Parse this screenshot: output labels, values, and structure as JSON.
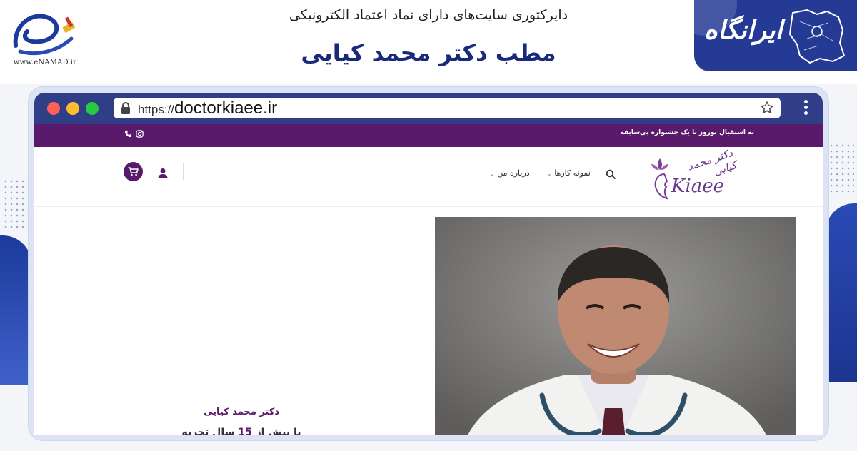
{
  "banner": {
    "enamad_url": "www.eNAMAD.ir",
    "subtitle": "دایرکتوری سایت‌های دارای نماد اعتماد الکترونیکی",
    "title": "مطب دکتر محمد کیایی",
    "brand_logo_text": "ایرانگاه"
  },
  "browser": {
    "url_protocol": "https://",
    "url_host": "doctorkiaee.ir"
  },
  "site": {
    "promo_text": "به استقبال نوروز با یک جشنواره بی‌سابقه",
    "logo_fa": "دکتر محمد کیایی",
    "logo_en": "Kiaee",
    "nav": [
      {
        "label": "نمونه کارها"
      },
      {
        "label": "درباره من"
      }
    ],
    "hero": {
      "doctor_name": "دکتر محمد کیایی",
      "experience_prefix": "با بیش از",
      "experience_years": "15",
      "experience_suffix": "سال تجربه"
    }
  },
  "colors": {
    "brand_purple": "#5a1a6b",
    "banner_blue": "#253a94",
    "title_navy": "#1a2a7a",
    "chrome_bar": "#2f3e86"
  }
}
